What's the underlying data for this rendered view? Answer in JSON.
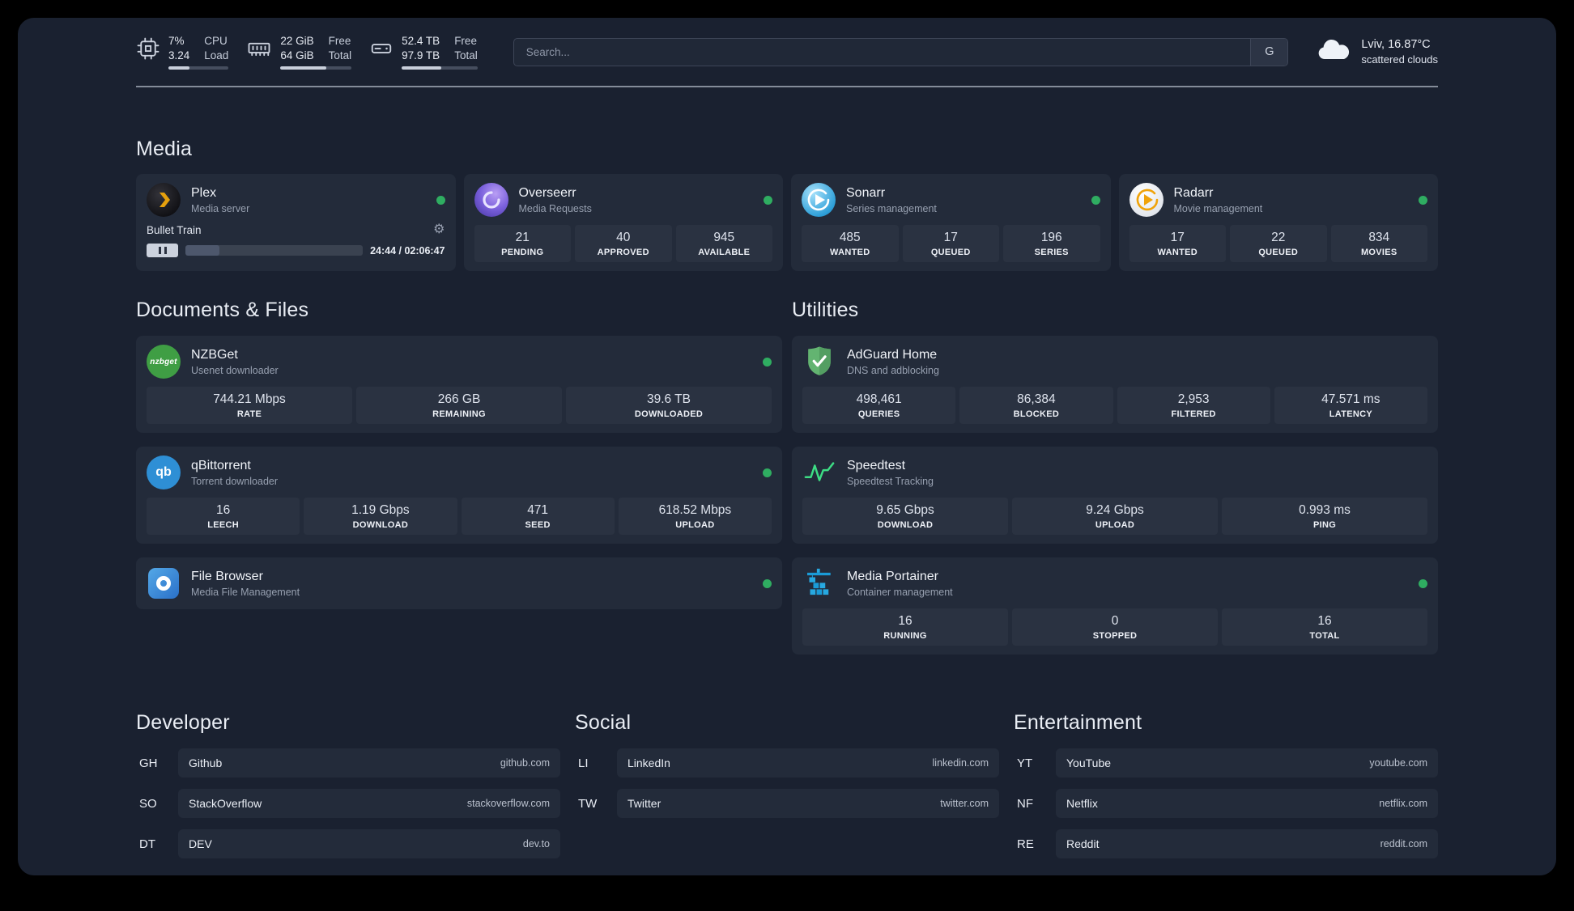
{
  "theme": {
    "bg": "#1a2130",
    "card": "#232b3a",
    "tile": "#2a3241",
    "text": "#e9edf4",
    "muted": "#97a0b0",
    "green": "#2fad61"
  },
  "icons": {
    "gear": "⚙"
  },
  "topbar": {
    "cpu": {
      "value": "7%",
      "load": "3.24",
      "label_top": "CPU",
      "label_bottom": "Load",
      "bar_percent": 35
    },
    "memory": {
      "free": "22 GiB",
      "total": "64 GiB",
      "label_top": "Free",
      "label_bottom": "Total",
      "bar_percent": 65
    },
    "disk": {
      "free": "52.4 TB",
      "total": "97.9 TB",
      "label_top": "Free",
      "label_bottom": "Total",
      "bar_percent": 52
    },
    "search": {
      "placeholder": "Search...",
      "provider_label": "G"
    },
    "weather": {
      "location": "Lviv, 16.87°C",
      "condition": "scattered clouds"
    }
  },
  "media": {
    "title": "Media",
    "cards": [
      {
        "name": "Plex",
        "desc": "Media server",
        "status": "online",
        "player": {
          "title": "Bullet Train",
          "time": "24:44 / 02:06:47",
          "progress_percent": 19
        }
      },
      {
        "name": "Overseerr",
        "desc": "Media Requests",
        "status": "online",
        "stats": [
          {
            "value": "21",
            "label": "PENDING"
          },
          {
            "value": "40",
            "label": "APPROVED"
          },
          {
            "value": "945",
            "label": "AVAILABLE"
          }
        ]
      },
      {
        "name": "Sonarr",
        "desc": "Series management",
        "status": "online",
        "stats": [
          {
            "value": "485",
            "label": "WANTED"
          },
          {
            "value": "17",
            "label": "QUEUED"
          },
          {
            "value": "196",
            "label": "SERIES"
          }
        ]
      },
      {
        "name": "Radarr",
        "desc": "Movie management",
        "status": "online",
        "stats": [
          {
            "value": "17",
            "label": "WANTED"
          },
          {
            "value": "22",
            "label": "QUEUED"
          },
          {
            "value": "834",
            "label": "MOVIES"
          }
        ]
      }
    ]
  },
  "documents": {
    "title": "Documents & Files",
    "cards": [
      {
        "name": "NZBGet",
        "desc": "Usenet downloader",
        "status": "online",
        "stats": [
          {
            "value": "744.21 Mbps",
            "label": "RATE"
          },
          {
            "value": "266 GB",
            "label": "REMAINING"
          },
          {
            "value": "39.6 TB",
            "label": "DOWNLOADED"
          }
        ]
      },
      {
        "name": "qBittorrent",
        "desc": "Torrent downloader",
        "status": "online",
        "stats": [
          {
            "value": "16",
            "label": "LEECH"
          },
          {
            "value": "1.19 Gbps",
            "label": "DOWNLOAD"
          },
          {
            "value": "471",
            "label": "SEED"
          },
          {
            "value": "618.52 Mbps",
            "label": "UPLOAD"
          }
        ]
      },
      {
        "name": "File Browser",
        "desc": "Media File Management",
        "status": "online"
      }
    ]
  },
  "utilities": {
    "title": "Utilities",
    "cards": [
      {
        "name": "AdGuard Home",
        "desc": "DNS and adblocking",
        "stats": [
          {
            "value": "498,461",
            "label": "QUERIES"
          },
          {
            "value": "86,384",
            "label": "BLOCKED"
          },
          {
            "value": "2,953",
            "label": "FILTERED"
          },
          {
            "value": "47.571 ms",
            "label": "LATENCY"
          }
        ]
      },
      {
        "name": "Speedtest",
        "desc": "Speedtest Tracking",
        "stats": [
          {
            "value": "9.65 Gbps",
            "label": "DOWNLOAD"
          },
          {
            "value": "9.24 Gbps",
            "label": "UPLOAD"
          },
          {
            "value": "0.993 ms",
            "label": "PING"
          }
        ]
      },
      {
        "name": "Media Portainer",
        "desc": "Container management",
        "status": "online",
        "stats": [
          {
            "value": "16",
            "label": "RUNNING"
          },
          {
            "value": "0",
            "label": "STOPPED"
          },
          {
            "value": "16",
            "label": "TOTAL"
          }
        ]
      }
    ]
  },
  "bookmarks": {
    "groups": [
      {
        "title": "Developer",
        "items": [
          {
            "abbr": "GH",
            "name": "Github",
            "domain": "github.com"
          },
          {
            "abbr": "SO",
            "name": "StackOverflow",
            "domain": "stackoverflow.com"
          },
          {
            "abbr": "DT",
            "name": "DEV",
            "domain": "dev.to"
          }
        ]
      },
      {
        "title": "Social",
        "items": [
          {
            "abbr": "LI",
            "name": "LinkedIn",
            "domain": "linkedin.com"
          },
          {
            "abbr": "TW",
            "name": "Twitter",
            "domain": "twitter.com"
          }
        ]
      },
      {
        "title": "Entertainment",
        "items": [
          {
            "abbr": "YT",
            "name": "YouTube",
            "domain": "youtube.com"
          },
          {
            "abbr": "NF",
            "name": "Netflix",
            "domain": "netflix.com"
          },
          {
            "abbr": "RE",
            "name": "Reddit",
            "domain": "reddit.com"
          }
        ]
      }
    ]
  }
}
